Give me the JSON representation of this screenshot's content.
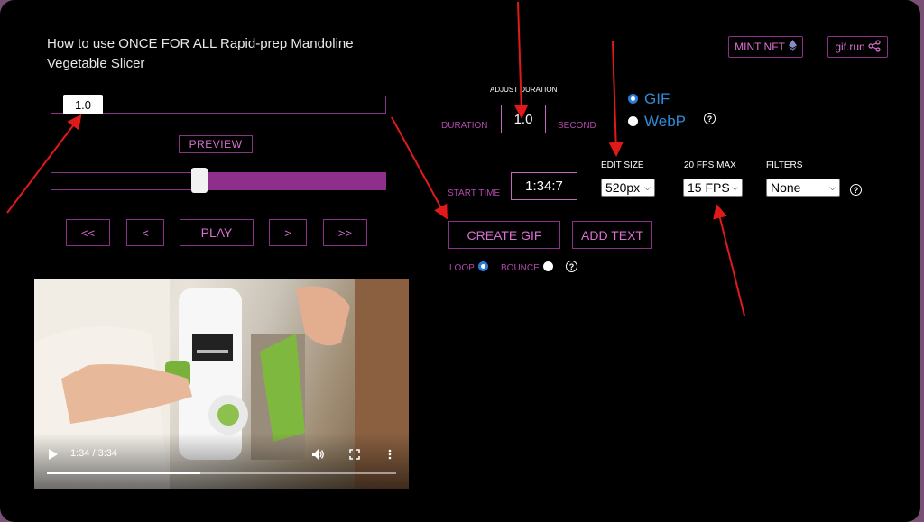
{
  "video": {
    "title": "How to use ONCE FOR ALL Rapid-prep Mandoline Vegetable Slicer",
    "time_display": "1:34 / 3:34",
    "progress": 0.44
  },
  "header": {
    "mint_label": "MINT NFT",
    "gifrun_label": "gif.run"
  },
  "speed": {
    "value": "1.0"
  },
  "preview_label": "PREVIEW",
  "range": {
    "start_fraction": 0.44,
    "end_fraction": 1.0
  },
  "nav": {
    "back_big": "<<",
    "back": "<",
    "play": "PLAY",
    "fwd": ">",
    "fwd_big": ">>"
  },
  "duration": {
    "adjust_label": "ADJUST DURATION",
    "label": "DURATION",
    "value": "1.0",
    "unit": "SECOND"
  },
  "start_time": {
    "label": "START TIME",
    "value": "1:34:7"
  },
  "format": {
    "options": [
      "GIF",
      "WebP"
    ],
    "selected": "GIF"
  },
  "edit_size": {
    "label": "EDIT SIZE",
    "value": "520px"
  },
  "fps": {
    "label": "20 FPS MAX",
    "value": "15 FPS"
  },
  "filters": {
    "label": "FILTERS",
    "value": "None"
  },
  "actions": {
    "create": "CREATE GIF",
    "add_text": "ADD TEXT"
  },
  "playback": {
    "loop_label": "LOOP",
    "bounce_label": "BOUNCE",
    "selected": "LOOP"
  },
  "colors": {
    "accent_purple": "#8e2f8c",
    "border_purple": "#8c2f86",
    "link_blue": "#2f8bd8",
    "arrow_red": "#e01a1a"
  }
}
